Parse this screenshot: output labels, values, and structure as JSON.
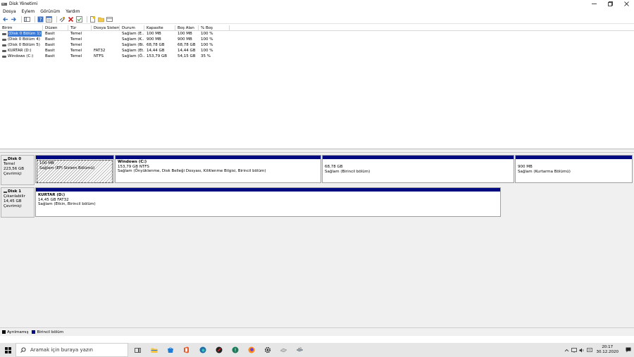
{
  "window": {
    "title": "Disk Yönetimi"
  },
  "menu": [
    "Dosya",
    "Eylem",
    "Görünüm",
    "Yardım"
  ],
  "toolbar_icons": [
    "back-icon",
    "forward-icon",
    "show-hide-console-icon",
    "help-icon",
    "properties-icon",
    "connect-icon",
    "delete-icon",
    "check-icon",
    "new-icon",
    "open-icon",
    "view-icon"
  ],
  "volume_list": {
    "columns": [
      "Birim",
      "Düzen",
      "Tür",
      "Dosya Sistemi",
      "Durum",
      "Kapasite",
      "Boş Alan",
      "% Boş"
    ],
    "rows": [
      [
        "(Disk 0 Bölüm 1)",
        "Basit",
        "Temel",
        "",
        "Sağlam (E...",
        "100 MB",
        "100 MB",
        "100 %"
      ],
      [
        "(Disk 0 Bölüm 4)",
        "Basit",
        "Temel",
        "",
        "Sağlam (K...",
        "900 MB",
        "900 MB",
        "100 %"
      ],
      [
        "(Disk 0 Bölüm 5)",
        "Basit",
        "Temel",
        "",
        "Sağlam (Bi...",
        "68,78 GB",
        "68,78 GB",
        "100 %"
      ],
      [
        "KURTAR (D:)",
        "Basit",
        "Temel",
        "FAT32",
        "Sağlam (Et...",
        "14,44 GB",
        "14,44 GB",
        "100 %"
      ],
      [
        "Windows (C:)",
        "Basit",
        "Temel",
        "NTFS",
        "Sağlam (Ö...",
        "153,79 GB",
        "54,15 GB",
        "35 %"
      ]
    ]
  },
  "disks": [
    {
      "name": "Disk 0",
      "type": "Temel",
      "size": "223,56 GB",
      "status": "Çevrimiçi",
      "partitions": [
        {
          "name": "",
          "size": "100 MB",
          "status": "Sağlam (EFI Sistem Bölümü)"
        },
        {
          "name": "Windows  (C:)",
          "size": "153,79 GB NTFS",
          "status": "Sağlam (Önyüklenme, Disk Belleği Dosyası, Kilitlenme Bilgisi, Birincil bölüm)"
        },
        {
          "name": "",
          "size": "68,78 GB",
          "status": "Sağlam (Birincil bölüm)"
        },
        {
          "name": "",
          "size": "900 MB",
          "status": "Sağlam (Kurtarma Bölümü)"
        }
      ]
    },
    {
      "name": "Disk 1",
      "type": "Çıkarılabilir",
      "size": "14,45 GB",
      "status": "Çevrimiçi",
      "partitions": [
        {
          "name": "KURTAR  (D:)",
          "size": "14,45 GB FAT32",
          "status": "Sağlam (Etkin, Birincil bölüm)"
        }
      ]
    }
  ],
  "legend": {
    "items": [
      {
        "label": "Ayrılmamış",
        "color": "#000000"
      },
      {
        "label": "Birincil bölüm",
        "color": "#000a80"
      }
    ]
  },
  "taskbar": {
    "search_placeholder": "Aramak için buraya yazın",
    "apps": [
      "task-view-icon",
      "file-explorer-icon",
      "store-icon",
      "office-icon",
      "edge-icon",
      "opera-icon",
      "chrome-icon",
      "firefox-icon",
      "settings-icon",
      "hdd-icon",
      "printer-icon"
    ],
    "time": "20:17",
    "date": "30.12.2020"
  },
  "colors": {
    "primary_partition": "#000a80",
    "selection": "#3a78d6"
  }
}
